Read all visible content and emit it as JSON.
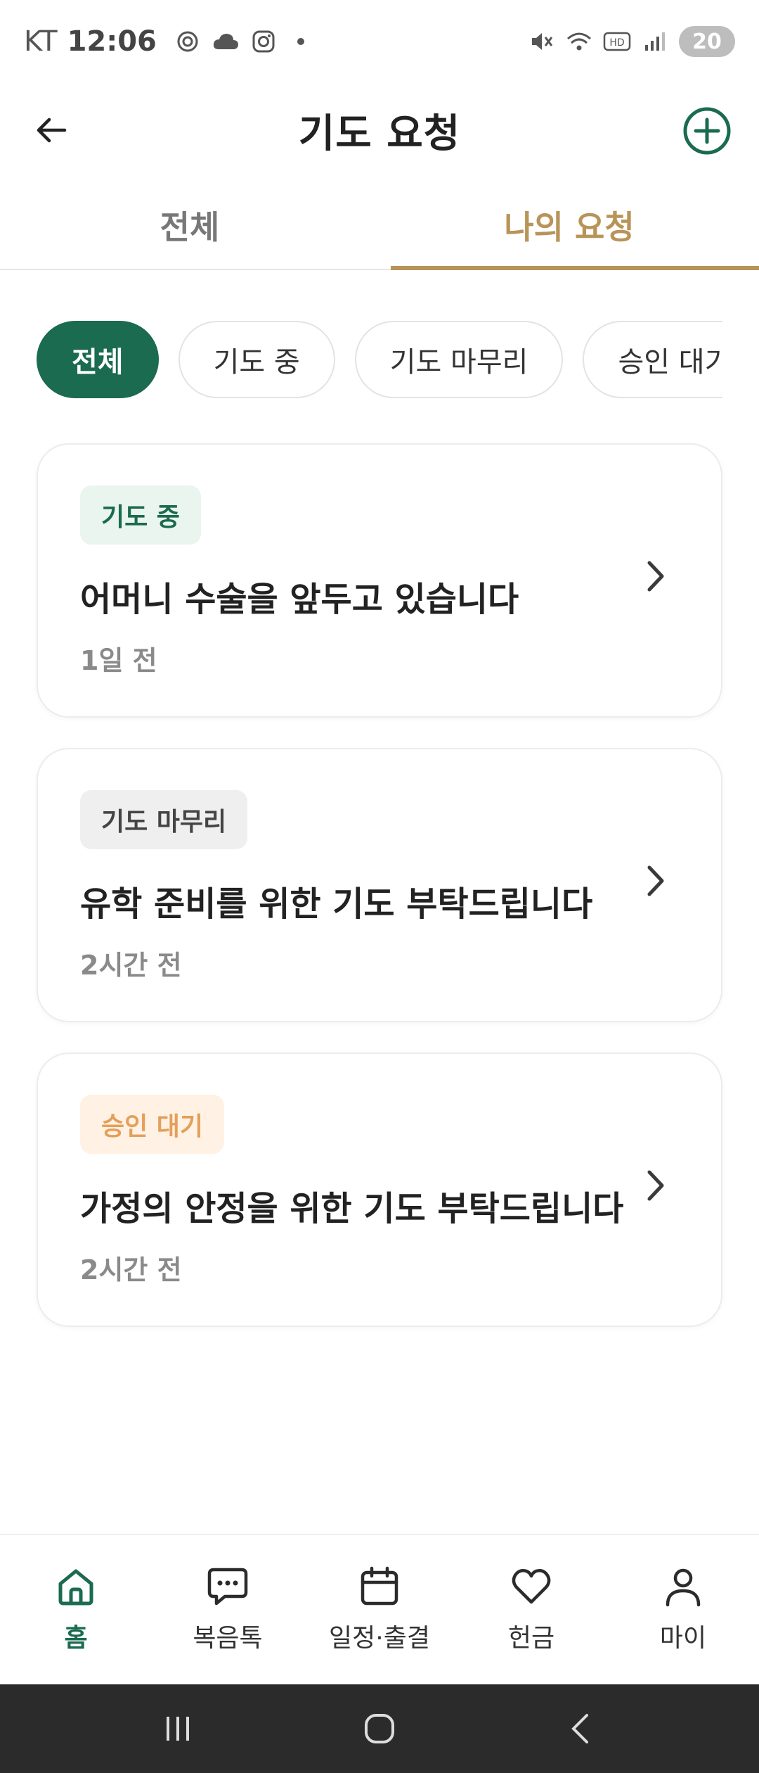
{
  "status_bar": {
    "carrier": "KT",
    "time": "12:06",
    "battery": "20"
  },
  "header": {
    "title": "기도 요청"
  },
  "tabs": [
    {
      "label": "전체",
      "active": false
    },
    {
      "label": "나의 요청",
      "active": true
    }
  ],
  "filters": [
    {
      "label": "전체",
      "active": true
    },
    {
      "label": "기도 중",
      "active": false
    },
    {
      "label": "기도 마무리",
      "active": false
    },
    {
      "label": "승인 대기",
      "active": false
    }
  ],
  "requests": [
    {
      "status": "기도 중",
      "title": "어머니 수술을 앞두고 있습니다",
      "time": "1일 전"
    },
    {
      "status": "기도 마무리",
      "title": "유학 준비를 위한 기도 부탁드립니다",
      "time": "2시간 전"
    },
    {
      "status": "승인 대기",
      "title": "가정의 안정을 위한 기도 부탁드립니다",
      "time": "2시간 전"
    }
  ],
  "bottom_nav": [
    {
      "label": "홈",
      "icon": "home-icon",
      "active": true
    },
    {
      "label": "복음톡",
      "icon": "chat-icon",
      "active": false
    },
    {
      "label": "일정·출결",
      "icon": "calendar-icon",
      "active": false
    },
    {
      "label": "헌금",
      "icon": "heart-icon",
      "active": false
    },
    {
      "label": "마이",
      "icon": "user-icon",
      "active": false
    }
  ],
  "colors": {
    "primary_green": "#1a6b4f",
    "accent_gold": "#b89458",
    "pending_orange": "#e3a05a"
  }
}
